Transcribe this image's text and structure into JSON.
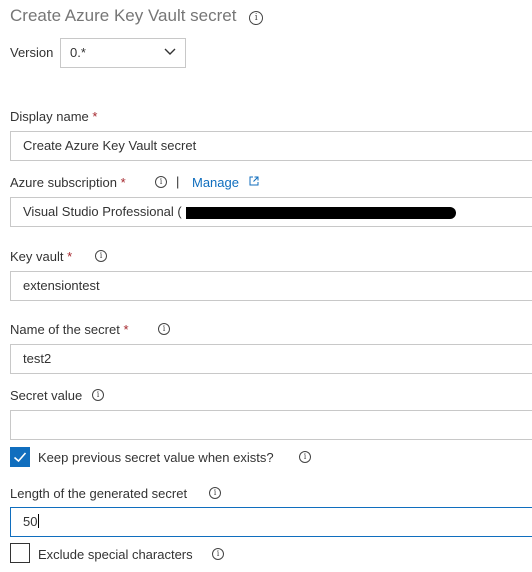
{
  "header": {
    "title": "Create Azure Key Vault secret"
  },
  "version": {
    "label": "Version",
    "value": "0.*"
  },
  "display_name": {
    "label": "Display name",
    "required": "*",
    "value": "Create Azure Key Vault secret"
  },
  "subscription": {
    "label": "Azure subscription",
    "required": "*",
    "separator": "|",
    "manage_label": "Manage",
    "value": "Visual Studio Professional ("
  },
  "key_vault": {
    "label": "Key vault",
    "required": "*",
    "value": "extensiontest"
  },
  "secret_name": {
    "label": "Name of the secret",
    "required": "*",
    "value": "test2"
  },
  "secret_value": {
    "label": "Secret value",
    "value": ""
  },
  "keep_previous": {
    "label": "Keep previous secret value when exists?",
    "checked": true
  },
  "length": {
    "label": "Length of the generated secret",
    "value": "50"
  },
  "exclude_special": {
    "label": "Exclude special characters",
    "checked": false
  },
  "colors": {
    "accent": "#106ebe",
    "required": "#a4262c",
    "title": "#767676"
  }
}
